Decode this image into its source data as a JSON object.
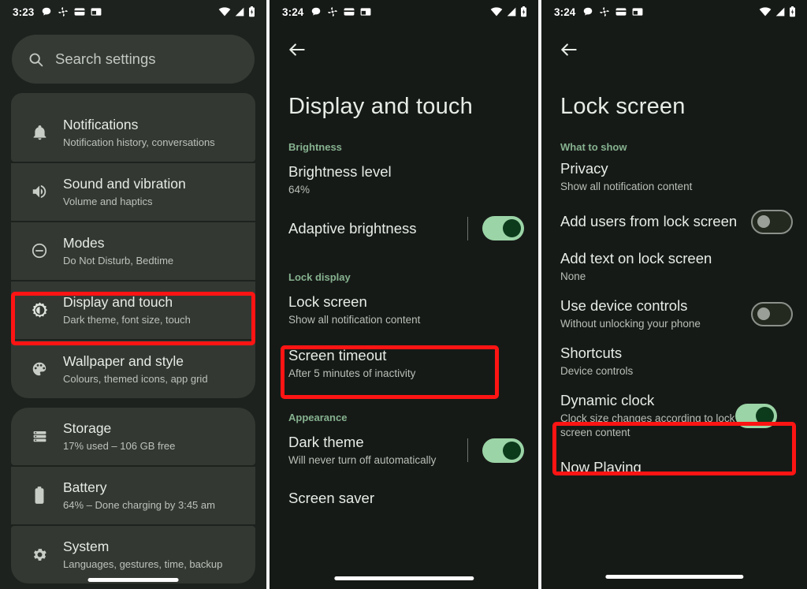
{
  "theme": {
    "accent_green": "#86b28f",
    "toggle_on_track": "#9bd4a6",
    "toggle_on_thumb": "#0c3b1c",
    "highlight_red": "#ff1414",
    "card_bg": "#343833",
    "page_bg": "#161a17"
  },
  "panel1": {
    "status_bar": {
      "time": "3:23",
      "left_icons": [
        "chat-bubble-icon",
        "pinwheel-icon",
        "wallet-icon",
        "picture-in-picture-icon"
      ],
      "right_icons": [
        "wifi-icon",
        "cellular-signal-icon",
        "battery-icon"
      ]
    },
    "back_icon": "",
    "search": {
      "placeholder": "Search settings",
      "icon": "search-icon"
    },
    "groups": [
      {
        "stub_above": true,
        "rows": [
          {
            "icon": "bell-icon",
            "title": "Notifications",
            "subtitle": "Notification history, conversations"
          },
          {
            "icon": "volume-icon",
            "title": "Sound and vibration",
            "subtitle": "Volume and haptics"
          },
          {
            "icon": "do-not-disturb-icon",
            "title": "Modes",
            "subtitle": "Do Not Disturb, Bedtime"
          },
          {
            "icon": "brightness-icon",
            "title": "Display and touch",
            "subtitle": "Dark theme, font size, touch"
          },
          {
            "icon": "palette-icon",
            "title": "Wallpaper and style",
            "subtitle": "Colours, themed icons, app grid"
          }
        ]
      },
      {
        "stub_above": false,
        "rows": [
          {
            "icon": "storage-icon",
            "title": "Storage",
            "subtitle": "17% used – 106 GB free"
          },
          {
            "icon": "battery-icon",
            "title": "Battery",
            "subtitle": "64% – Done charging by 3:45 am"
          },
          {
            "icon": "gear-icon",
            "title": "System",
            "subtitle": "Languages, gestures, time, backup"
          }
        ]
      }
    ]
  },
  "panel2": {
    "status_bar": {
      "time": "3:24",
      "left_icons": [
        "chat-bubble-icon",
        "pinwheel-icon",
        "wallet-icon",
        "picture-in-picture-icon"
      ],
      "right_icons": [
        "wifi-icon",
        "cellular-signal-icon",
        "battery-icon"
      ]
    },
    "title": "Display and touch",
    "sections": [
      {
        "header": "Brightness",
        "items": [
          {
            "title": "Brightness level",
            "subtitle": "64%",
            "toggle": null
          },
          {
            "title": "Adaptive brightness",
            "subtitle": "",
            "toggle": "on"
          }
        ]
      },
      {
        "header": "Lock display",
        "items": [
          {
            "title": "Lock screen",
            "subtitle": "Show all notification content",
            "toggle": null
          },
          {
            "title": "Screen timeout",
            "subtitle": "After 5 minutes of inactivity",
            "toggle": null
          }
        ]
      },
      {
        "header": "Appearance",
        "items": [
          {
            "title": "Dark theme",
            "subtitle": "Will never turn off automatically",
            "toggle": "on"
          },
          {
            "title": "Screen saver",
            "subtitle": "",
            "toggle": null
          }
        ]
      }
    ]
  },
  "panel3": {
    "status_bar": {
      "time": "3:24",
      "left_icons": [
        "chat-bubble-icon",
        "pinwheel-icon",
        "wallet-icon",
        "picture-in-picture-icon"
      ],
      "right_icons": [
        "wifi-icon",
        "cellular-signal-icon",
        "battery-icon"
      ]
    },
    "title": "Lock screen",
    "sections": [
      {
        "header": "What to show",
        "items": [
          {
            "title": "Privacy",
            "subtitle": "Show all notification content",
            "toggle": null
          },
          {
            "title": "Add users from lock screen",
            "subtitle": "",
            "toggle": "off"
          },
          {
            "title": "Add text on lock screen",
            "subtitle": "None",
            "toggle": null
          },
          {
            "title": "Use device controls",
            "subtitle": "Without unlocking your phone",
            "toggle": "off"
          },
          {
            "title": "Shortcuts",
            "subtitle": "Device controls",
            "toggle": null
          },
          {
            "title": "Dynamic clock",
            "subtitle": "Clock size changes according to lock screen content",
            "toggle": "on"
          },
          {
            "title": "Now Playing",
            "subtitle": "",
            "toggle": null
          }
        ]
      }
    ]
  },
  "annotations": [
    {
      "name": "highlight-display-and-touch",
      "panel": 1
    },
    {
      "name": "highlight-lock-screen",
      "panel": 2
    },
    {
      "name": "highlight-shortcuts",
      "panel": 3
    }
  ]
}
